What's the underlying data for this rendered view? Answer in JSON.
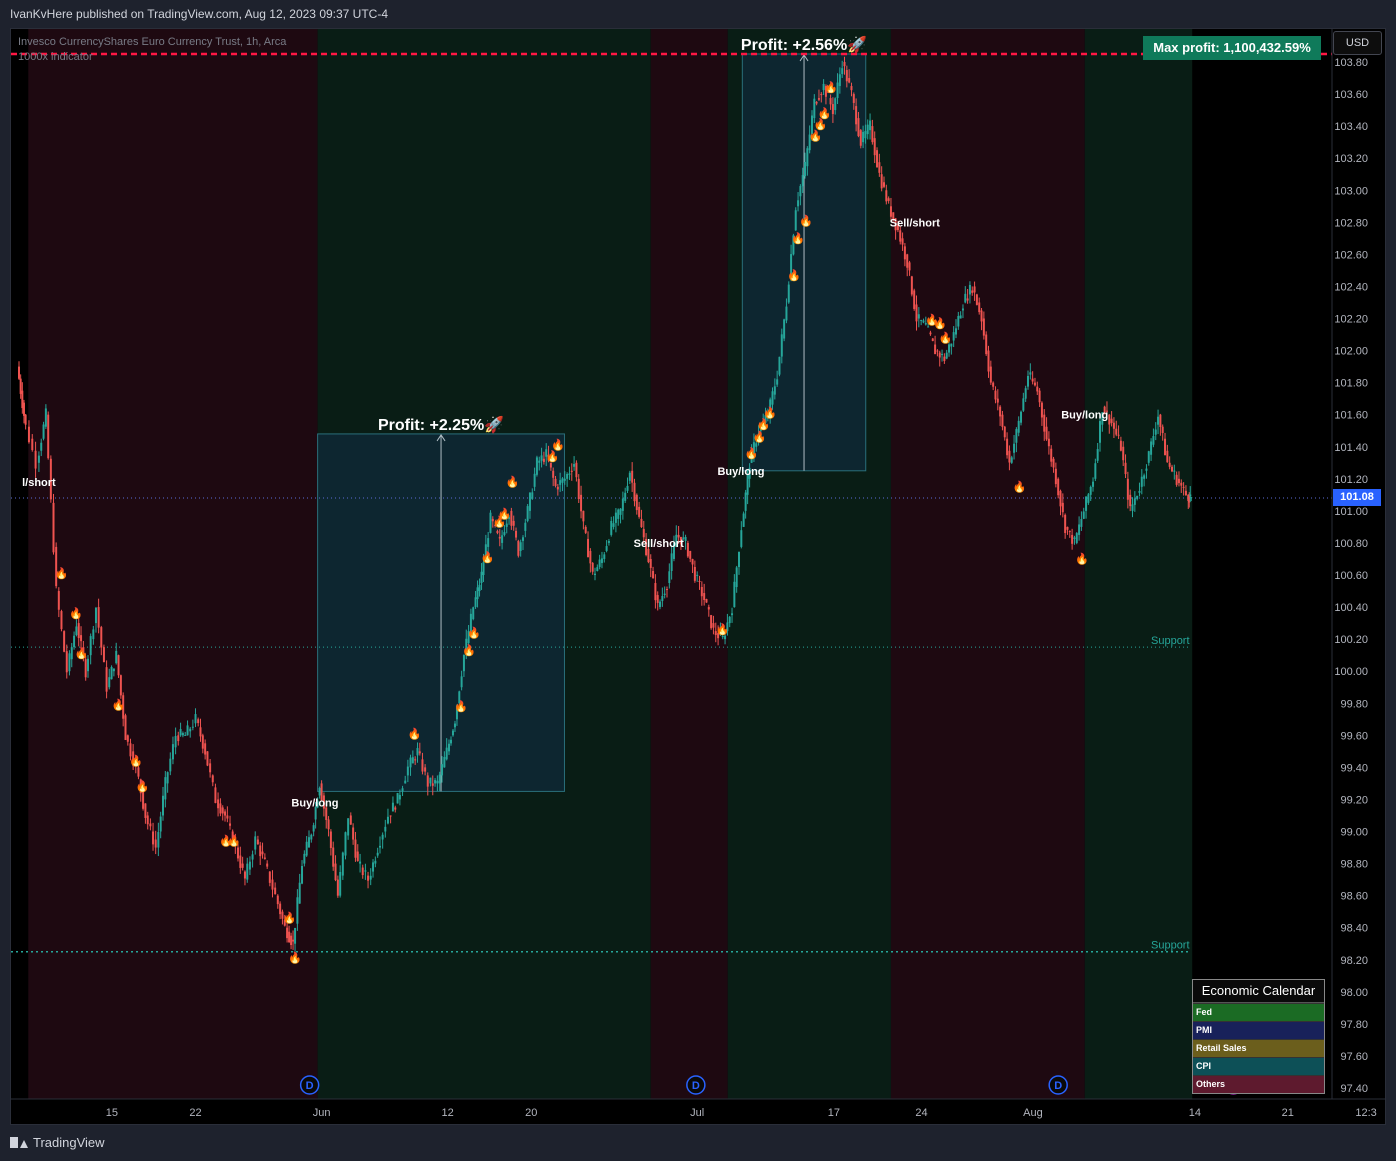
{
  "publisher_line": "IvanKvHere published on TradingView.com, Aug 12, 2023 09:37 UTC-4",
  "legend": {
    "symbol_line": "Invesco CurrencyShares Euro Currency Trust, 1h, Arca",
    "indicator_line": "1000x indicator"
  },
  "currency_button": "USD",
  "max_profit_label": "Max profit:  1,100,432.59%",
  "last_price": "101.08",
  "footer_brand": "TradingView",
  "colors": {
    "bull_zone": "#091d15",
    "bear_zone": "#1e0911",
    "up_candle": "#26a69a",
    "down_candle": "#ef5350",
    "support_line": "#26a69a",
    "max_line": "#ff1744",
    "price_line": "#5b6bd5",
    "trade_box_fill": "#0f2a3a",
    "trade_box_stroke": "#2a6f7a"
  },
  "chart_data": {
    "type": "candlestick",
    "title": "Invesco CurrencyShares Euro Currency Trust, 1h, Arca",
    "ylabel": "USD",
    "ylim": [
      97.3,
      103.9
    ],
    "y_ticks": [
      "103.80",
      "103.60",
      "103.40",
      "103.20",
      "103.00",
      "102.80",
      "102.60",
      "102.40",
      "102.20",
      "102.00",
      "101.80",
      "101.60",
      "101.40",
      "101.20",
      "101.00",
      "100.80",
      "100.60",
      "100.40",
      "100.20",
      "100.00",
      "99.80",
      "99.60",
      "99.40",
      "99.20",
      "99.00",
      "98.80",
      "98.60",
      "98.40",
      "98.20",
      "98.00",
      "97.80",
      "97.60",
      "97.40"
    ],
    "x_ticks": [
      {
        "label": "15",
        "x": 10
      },
      {
        "label": "22",
        "x": 16.3
      },
      {
        "label": "Jun",
        "x": 25.8
      },
      {
        "label": "12",
        "x": 35.3
      },
      {
        "label": "20",
        "x": 41.6
      },
      {
        "label": "Jul",
        "x": 54.1
      },
      {
        "label": "17",
        "x": 64.4
      },
      {
        "label": "24",
        "x": 71
      },
      {
        "label": "Aug",
        "x": 79.4
      },
      {
        "label": "14",
        "x": 91.6
      },
      {
        "label": "21",
        "x": 98.6
      },
      {
        "label": "12:3",
        "x": 104.5
      }
    ],
    "x_range": [
      3,
      106
    ],
    "zones": [
      {
        "kind": "bear",
        "x0": 3.7,
        "x1": 25.5
      },
      {
        "kind": "bull",
        "x0": 25.5,
        "x1": 50.6
      },
      {
        "kind": "bear",
        "x0": 50.6,
        "x1": 56.4
      },
      {
        "kind": "bull",
        "x0": 56.4,
        "x1": 68.7
      },
      {
        "kind": "bear",
        "x0": 68.7,
        "x1": 83.3
      },
      {
        "kind": "bull",
        "x0": 83.3,
        "x1": 91.4
      }
    ],
    "price_path": [
      [
        3.0,
        101.9
      ],
      [
        3.5,
        101.6
      ],
      [
        4.5,
        101.3
      ],
      [
        5.2,
        101.6
      ],
      [
        6.0,
        100.5
      ],
      [
        6.8,
        100.0
      ],
      [
        7.5,
        100.3
      ],
      [
        8.2,
        100.0
      ],
      [
        9.0,
        100.4
      ],
      [
        9.8,
        99.9
      ],
      [
        10.5,
        100.1
      ],
      [
        11.2,
        99.6
      ],
      [
        12.0,
        99.4
      ],
      [
        12.7,
        99.1
      ],
      [
        13.5,
        98.9
      ],
      [
        14.2,
        99.3
      ],
      [
        15.0,
        99.6
      ],
      [
        15.7,
        99.6
      ],
      [
        16.5,
        99.7
      ],
      [
        17.2,
        99.5
      ],
      [
        18.0,
        99.2
      ],
      [
        18.7,
        99.1
      ],
      [
        19.5,
        98.9
      ],
      [
        20.2,
        98.7
      ],
      [
        21.0,
        98.95
      ],
      [
        21.7,
        98.8
      ],
      [
        22.5,
        98.6
      ],
      [
        23.2,
        98.4
      ],
      [
        23.8,
        98.3
      ],
      [
        24.5,
        98.8
      ],
      [
        25.2,
        99.0
      ],
      [
        25.8,
        99.3
      ],
      [
        26.5,
        99.0
      ],
      [
        27.2,
        98.6
      ],
      [
        28.0,
        99.1
      ],
      [
        28.7,
        98.8
      ],
      [
        29.5,
        98.7
      ],
      [
        30.2,
        98.9
      ],
      [
        31.0,
        99.1
      ],
      [
        31.7,
        99.2
      ],
      [
        32.5,
        99.4
      ],
      [
        33.2,
        99.5
      ],
      [
        34.0,
        99.3
      ],
      [
        34.7,
        99.3
      ],
      [
        35.4,
        99.5
      ],
      [
        36.0,
        99.7
      ],
      [
        36.7,
        100.1
      ],
      [
        37.4,
        100.4
      ],
      [
        38.0,
        100.6
      ],
      [
        38.7,
        100.95
      ],
      [
        39.4,
        100.8
      ],
      [
        40.1,
        101.0
      ],
      [
        40.8,
        100.75
      ],
      [
        41.5,
        101.0
      ],
      [
        42.2,
        101.3
      ],
      [
        42.9,
        101.35
      ],
      [
        43.6,
        101.15
      ],
      [
        44.3,
        101.2
      ],
      [
        45.0,
        101.3
      ],
      [
        45.7,
        100.9
      ],
      [
        46.4,
        100.6
      ],
      [
        47.1,
        100.7
      ],
      [
        47.8,
        100.9
      ],
      [
        48.5,
        101.0
      ],
      [
        49.2,
        101.25
      ],
      [
        49.9,
        100.95
      ],
      [
        50.6,
        100.7
      ],
      [
        51.3,
        100.4
      ],
      [
        52.0,
        100.55
      ],
      [
        52.7,
        100.85
      ],
      [
        53.4,
        100.8
      ],
      [
        54.1,
        100.6
      ],
      [
        54.8,
        100.45
      ],
      [
        55.5,
        100.25
      ],
      [
        56.2,
        100.2
      ],
      [
        56.9,
        100.4
      ],
      [
        57.6,
        100.9
      ],
      [
        58.2,
        101.3
      ],
      [
        58.9,
        101.5
      ],
      [
        59.6,
        101.6
      ],
      [
        60.3,
        101.85
      ],
      [
        61.0,
        102.3
      ],
      [
        61.7,
        102.9
      ],
      [
        62.4,
        103.15
      ],
      [
        63.1,
        103.55
      ],
      [
        63.8,
        103.65
      ],
      [
        64.5,
        103.5
      ],
      [
        65.2,
        103.8
      ],
      [
        65.9,
        103.6
      ],
      [
        66.6,
        103.3
      ],
      [
        67.3,
        103.4
      ],
      [
        68.0,
        103.1
      ],
      [
        68.7,
        102.9
      ],
      [
        69.4,
        102.75
      ],
      [
        70.1,
        102.55
      ],
      [
        70.8,
        102.2
      ],
      [
        71.5,
        102.15
      ],
      [
        72.2,
        102.0
      ],
      [
        72.9,
        101.95
      ],
      [
        73.6,
        102.1
      ],
      [
        74.3,
        102.3
      ],
      [
        75.0,
        102.4
      ],
      [
        75.7,
        102.2
      ],
      [
        76.4,
        101.8
      ],
      [
        77.1,
        101.6
      ],
      [
        77.8,
        101.3
      ],
      [
        78.5,
        101.55
      ],
      [
        79.2,
        101.85
      ],
      [
        79.9,
        101.75
      ],
      [
        80.6,
        101.45
      ],
      [
        81.3,
        101.2
      ],
      [
        82.0,
        100.9
      ],
      [
        82.7,
        100.8
      ],
      [
        83.4,
        101.0
      ],
      [
        84.1,
        101.2
      ],
      [
        84.8,
        101.65
      ],
      [
        85.5,
        101.55
      ],
      [
        86.2,
        101.4
      ],
      [
        86.9,
        101.0
      ],
      [
        87.6,
        101.15
      ],
      [
        88.3,
        101.35
      ],
      [
        89.0,
        101.6
      ],
      [
        89.7,
        101.3
      ],
      [
        90.4,
        101.2
      ],
      [
        91.1,
        101.1
      ],
      [
        91.4,
        101.08
      ]
    ],
    "horizontal_lines": [
      {
        "kind": "max",
        "price": 103.85
      },
      {
        "kind": "last",
        "price": 101.08
      },
      {
        "kind": "support",
        "price": 100.15,
        "label": "Support"
      },
      {
        "kind": "support",
        "price": 98.25,
        "label": "Support"
      }
    ],
    "trades": [
      {
        "x0": 25.5,
        "x1": 44.1,
        "y0": 99.25,
        "y1": 101.48,
        "profit": "Profit: +2.25%🚀"
      },
      {
        "x0": 57.5,
        "x1": 66.8,
        "y0": 101.25,
        "y1": 103.85,
        "profit": "Profit: +2.56%🚀"
      }
    ],
    "signals": [
      {
        "text": "l/short",
        "x": 4.5,
        "y": 101.18
      },
      {
        "text": "Buy/long",
        "x": 25.3,
        "y": 99.18
      },
      {
        "text": "Sell/short",
        "x": 51.2,
        "y": 100.8
      },
      {
        "text": "Buy/long",
        "x": 57.4,
        "y": 101.25
      },
      {
        "text": "Sell/short",
        "x": 70.5,
        "y": 102.8
      },
      {
        "text": "Buy/long",
        "x": 83.3,
        "y": 101.6
      }
    ],
    "flames": [
      [
        6.2,
        100.65
      ],
      [
        7.3,
        100.4
      ],
      [
        7.7,
        100.15
      ],
      [
        10.5,
        99.83
      ],
      [
        11.8,
        99.48
      ],
      [
        12.3,
        99.32
      ],
      [
        18.6,
        98.98
      ],
      [
        19.2,
        98.98
      ],
      [
        23.4,
        98.5
      ],
      [
        23.8,
        98.25
      ],
      [
        32.8,
        99.65
      ],
      [
        36.3,
        99.82
      ],
      [
        36.9,
        100.17
      ],
      [
        37.3,
        100.28
      ],
      [
        38.3,
        100.75
      ],
      [
        39.2,
        100.97
      ],
      [
        39.6,
        101.02
      ],
      [
        40.2,
        101.22
      ],
      [
        43.2,
        101.38
      ],
      [
        43.6,
        101.45
      ],
      [
        56.0,
        100.3
      ],
      [
        58.2,
        101.4
      ],
      [
        58.8,
        101.5
      ],
      [
        59.1,
        101.58
      ],
      [
        59.6,
        101.65
      ],
      [
        61.4,
        102.51
      ],
      [
        61.7,
        102.74
      ],
      [
        62.3,
        102.85
      ],
      [
        63.0,
        103.38
      ],
      [
        63.4,
        103.45
      ],
      [
        63.7,
        103.52
      ],
      [
        64.2,
        103.68
      ],
      [
        71.8,
        102.23
      ],
      [
        72.4,
        102.21
      ],
      [
        72.8,
        102.12
      ],
      [
        78.4,
        101.19
      ],
      [
        83.1,
        100.74
      ]
    ],
    "event_markers": [
      {
        "x": 24.9,
        "glyph": "D"
      },
      {
        "x": 54.0,
        "glyph": "D"
      },
      {
        "x": 81.3,
        "glyph": "D"
      },
      {
        "x": 94.5,
        "glyph": "⚡"
      }
    ],
    "economic_calendar": {
      "title": "Economic Calendar",
      "items": [
        {
          "label": "Fed",
          "color": "#1b6b24"
        },
        {
          "label": "PMI",
          "color": "#18215a"
        },
        {
          "label": "Retail Sales",
          "color": "#6b5e1c"
        },
        {
          "label": "CPI",
          "color": "#0d5057"
        },
        {
          "label": "Others",
          "color": "#5e1a2e"
        }
      ]
    }
  }
}
